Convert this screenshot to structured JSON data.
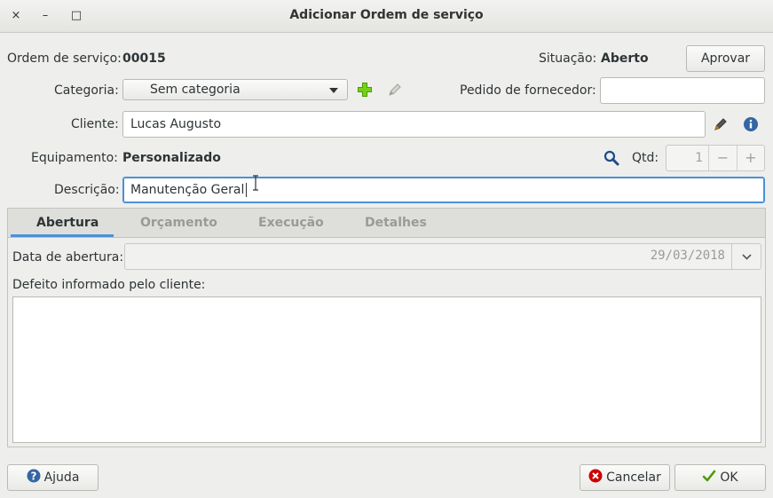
{
  "window": {
    "title": "Adicionar Ordem de serviço",
    "close_glyph": "×",
    "minimize_glyph": "–",
    "maximize_glyph": "□"
  },
  "header": {
    "order_label": "Ordem de serviço:",
    "order_value": "00015",
    "status_label": "Situação:",
    "status_value": "Aberto",
    "approve_button": "Aprovar"
  },
  "form": {
    "category_label": "Categoria:",
    "category_value": "Sem categoria",
    "supplier_order_label": "Pedido de fornecedor:",
    "supplier_order_value": "",
    "client_label": "Cliente:",
    "client_value": "Lucas Augusto",
    "equipment_label": "Equipamento:",
    "equipment_value": "Personalizado",
    "qty_label": "Qtd:",
    "qty_value": "1",
    "qty_minus": "−",
    "qty_plus": "+",
    "description_label": "Descrição:",
    "description_value": "Manutenção Geral"
  },
  "tabs": [
    {
      "label": "Abertura",
      "active": true
    },
    {
      "label": "Orçamento",
      "active": false
    },
    {
      "label": "Execução",
      "active": false
    },
    {
      "label": "Detalhes",
      "active": false
    }
  ],
  "abertura": {
    "date_label": "Data de abertura:",
    "date_value": "29/03/2018",
    "defect_label": "Defeito informado pelo cliente:",
    "defect_value": ""
  },
  "footer": {
    "help_button": "Ajuda",
    "cancel_button": "Cancelar",
    "ok_button": "OK"
  },
  "colors": {
    "accent": "#4a90d9",
    "add_icon": "#73d216",
    "cancel_icon": "#cc0000",
    "ok_icon": "#73d216",
    "info_icon": "#3465a4"
  },
  "icons": [
    "add-icon",
    "edit-icon",
    "info-icon",
    "search-icon",
    "help-icon",
    "cancel-icon",
    "ok-icon",
    "chevron-down-icon"
  ]
}
